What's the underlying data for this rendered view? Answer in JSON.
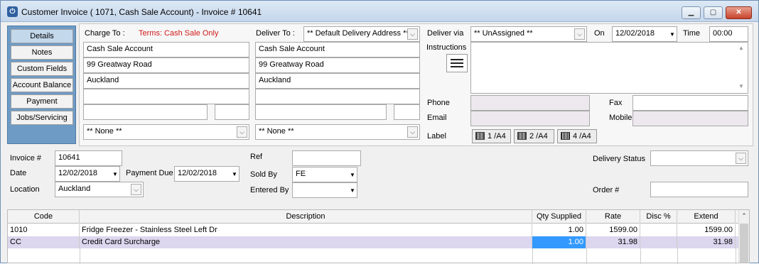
{
  "window": {
    "title": "Customer Invoice ( 1071, Cash Sale Account) - Invoice # 10641",
    "icon": "power-icon"
  },
  "sidebar": {
    "items": [
      {
        "label": "Details",
        "active": true
      },
      {
        "label": "Notes",
        "active": false
      },
      {
        "label": "Custom Fields",
        "active": false
      },
      {
        "label": "Account Balance",
        "active": false
      },
      {
        "label": "Payment",
        "active": false
      },
      {
        "label": "Jobs/Servicing",
        "active": false
      }
    ]
  },
  "charge_to": {
    "label": "Charge To :",
    "terms": "Terms: Cash Sale Only",
    "lines": [
      "Cash Sale Account",
      "99 Greatway Road",
      "Auckland",
      "",
      ""
    ],
    "postcode": "",
    "none_option": "** None **"
  },
  "deliver_to": {
    "label": "Deliver To :",
    "address_select": "** Default Delivery Address **",
    "lines": [
      "Cash Sale Account",
      "99 Greatway Road",
      "Auckland",
      "",
      ""
    ],
    "postcode": "",
    "none_option": "** None **"
  },
  "delivery": {
    "via_label": "Deliver via",
    "via_value": "** UnAssigned **",
    "on_label": "On",
    "on_value": "12/02/2018",
    "time_label": "Time",
    "time_value": "00:00",
    "instructions_label": "Instructions",
    "instructions_value": ""
  },
  "contact": {
    "phone_label": "Phone",
    "phone_value": "",
    "fax_label": "Fax",
    "fax_value": "",
    "email_label": "Email",
    "email_value": "",
    "mobile_label": "Mobile",
    "mobile_value": "",
    "label_label": "Label",
    "label_buttons": [
      "1 /A4",
      "2 /A4",
      "4 /A4"
    ]
  },
  "invoice": {
    "number_label": "Invoice #",
    "number_value": "10641",
    "date_label": "Date",
    "date_value": "12/02/2018",
    "payment_due_label": "Payment Due",
    "payment_due_value": "12/02/2018",
    "location_label": "Location",
    "location_value": "Auckland",
    "ref_label": "Ref",
    "ref_value": "",
    "sold_by_label": "Sold By",
    "sold_by_value": "FE",
    "entered_by_label": "Entered By",
    "entered_by_value": "",
    "delivery_status_label": "Delivery Status",
    "delivery_status_value": "",
    "order_label": "Order #",
    "order_value": ""
  },
  "lines_table": {
    "columns": [
      "Code",
      "Description",
      "Qty Supplied",
      "Rate",
      "Disc %",
      "Extend"
    ],
    "rows": [
      {
        "code": "1010",
        "description": "Fridge Freezer - Stainless Steel Left Dr",
        "qty": "1.00",
        "rate": "1599.00",
        "disc": "",
        "extend": "1599.00"
      },
      {
        "code": "CC",
        "description": "Credit Card Surcharge",
        "qty": "1.00",
        "rate": "31.98",
        "disc": "",
        "extend": "31.98"
      }
    ]
  },
  "colors": {
    "sidebar_bg": "#6e9bc6",
    "terms_red": "#d01818",
    "selected_row": "#dcd6ee",
    "selected_cell": "#3399ff"
  }
}
